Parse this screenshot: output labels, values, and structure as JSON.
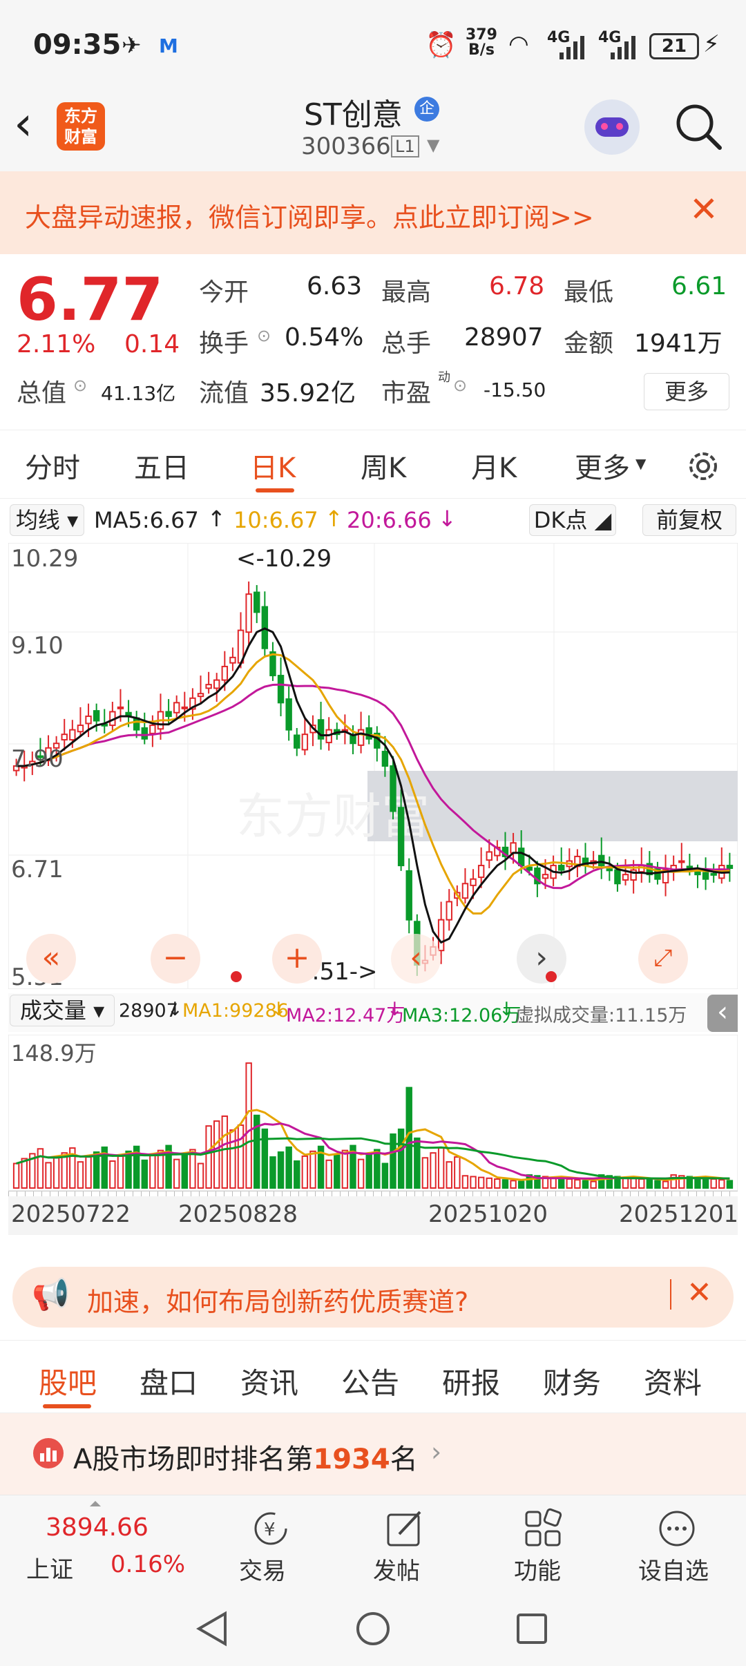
{
  "status_bar": {
    "time": "09:35",
    "net_speed_top": "379",
    "net_speed_bottom": "B/s",
    "net1": "4G",
    "net2": "4G",
    "battery": "21"
  },
  "header": {
    "logo_line1": "东方",
    "logo_line2": "财富",
    "stock_name": "ST创意",
    "badge": "企",
    "stock_code": "300366",
    "level": "L1"
  },
  "banner": {
    "text": "大盘异动速报，微信订阅即享。点此立即订阅>>"
  },
  "quote": {
    "price": "6.77",
    "change_pct": "2.11%",
    "change_abs": "0.14",
    "open_label": "今开",
    "open": "6.63",
    "high_label": "最高",
    "high": "6.78",
    "low_label": "最低",
    "low": "6.61",
    "turnover_label": "换手",
    "turnover": "0.54%",
    "volume_label": "总手",
    "volume": "28907",
    "amount_label": "金额",
    "amount": "1941万",
    "mktcap_label": "总值",
    "mktcap": "41.13亿",
    "float_label": "流值",
    "float": "35.92亿",
    "pe_label": "市盈",
    "pe_sup": "动",
    "pe": "-15.50",
    "more_label": "更多"
  },
  "tabs": [
    "分时",
    "五日",
    "日K",
    "周K",
    "月K",
    "更多"
  ],
  "ma_bar": {
    "selector": "均线",
    "ma5": "MA5:6.67",
    "ma10": "10:6.67",
    "ma20": "20:6.66",
    "dk": "DK点",
    "adjust": "前复权"
  },
  "kline": {
    "y_top": "10.29",
    "y_2": "9.10",
    "y_3": "7.90",
    "y_4": "6.71",
    "y_bottom": "5.51",
    "max_label": "<-10.29",
    "min_label": "5.51->",
    "watermark": "东方财富"
  },
  "volume_bar": {
    "selector": "成交量",
    "vol": "28907",
    "ma1": "MA1:99286",
    "ma2": "MA2:12.47万",
    "ma3": "MA3:12.06万",
    "virtual": "虚拟成交量:11.15万",
    "y_top": "148.9万"
  },
  "dates": [
    "20250722",
    "20250828",
    "20251020",
    "20251201"
  ],
  "ad": {
    "text": "加速，如何布局创新药优质赛道?"
  },
  "subtabs": [
    "股吧",
    "盘口",
    "资讯",
    "公告",
    "研报",
    "财务",
    "资料"
  ],
  "rank": {
    "prefix": "A股市场即时排名第",
    "num": "1934",
    "suffix": "名"
  },
  "bottom": {
    "index_value": "3894.66",
    "index_name": "上证",
    "index_pct": "0.16%",
    "trade": "交易",
    "post": "发帖",
    "func": "功能",
    "watch": "设自选"
  },
  "chart_data": {
    "type": "candlestick",
    "y_axis_ticks": [
      10.29,
      9.1,
      7.9,
      6.71,
      5.51
    ],
    "ylim": [
      5.51,
      10.29
    ],
    "x_ticks": [
      "20250722",
      "20250828",
      "20251020",
      "20251201"
    ],
    "annotations": [
      "<-10.29",
      "5.51->"
    ],
    "series_legend": [
      "MA5:6.67",
      "10:6.67",
      "20:6.66"
    ],
    "closes": [
      7.9,
      7.9,
      7.95,
      8.0,
      8.1,
      8.15,
      8.25,
      8.3,
      8.35,
      8.45,
      8.4,
      8.35,
      8.5,
      8.55,
      8.45,
      8.3,
      8.2,
      8.35,
      8.5,
      8.45,
      8.6,
      8.55,
      8.65,
      8.7,
      8.8,
      8.85,
      9.0,
      9.1,
      9.4,
      9.8,
      9.6,
      9.2,
      8.9,
      8.6,
      8.3,
      8.1,
      8.25,
      8.35,
      8.2,
      8.3,
      8.25,
      8.3,
      8.15,
      8.3,
      8.2,
      8.1,
      7.9,
      7.4,
      6.8,
      6.2,
      5.7,
      5.75,
      5.9,
      6.2,
      6.4,
      6.5,
      6.6,
      6.65,
      6.8,
      6.95,
      7.0,
      6.9,
      7.05,
      6.8,
      6.75,
      6.6,
      6.7,
      6.8,
      6.75,
      6.85,
      6.9,
      6.8,
      6.85,
      6.8,
      6.75,
      6.6,
      6.7,
      6.75,
      6.8,
      6.7,
      6.65,
      6.75,
      6.8,
      6.85,
      6.75,
      6.7,
      6.65,
      6.7,
      6.8,
      6.77
    ],
    "volume_ylim": [
      0,
      148.9
    ]
  }
}
